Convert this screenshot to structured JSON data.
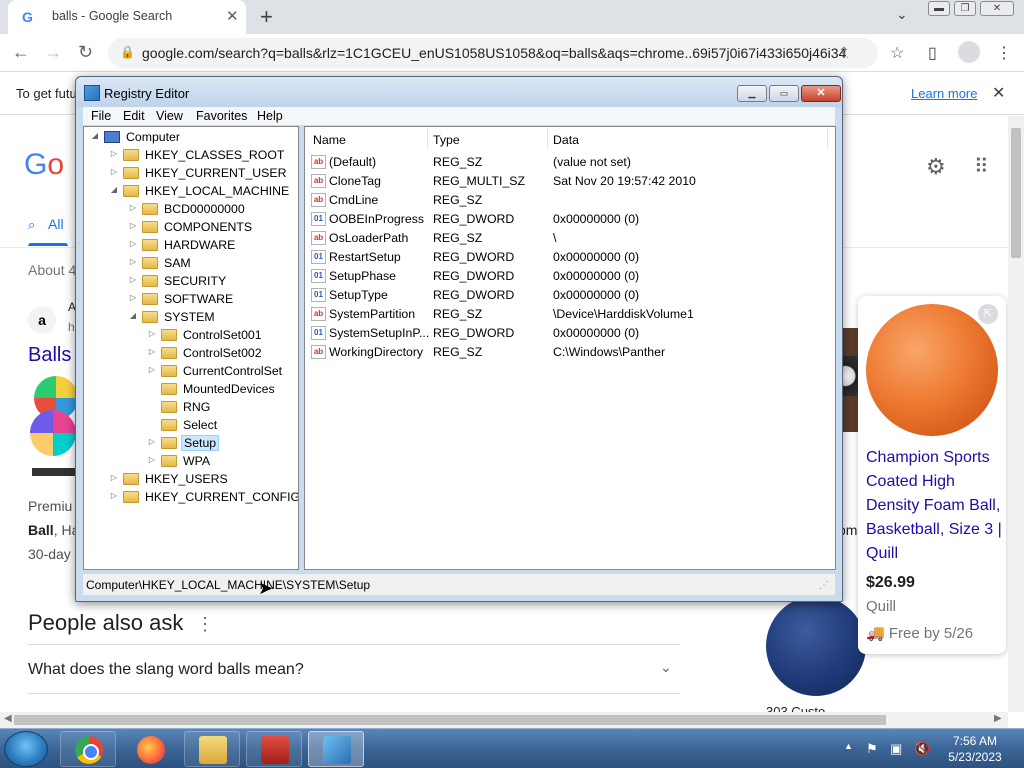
{
  "browser": {
    "tab_title": "balls - Google Search",
    "tab_favicon": "G",
    "new_tab": "+",
    "url": "google.com/search?q=balls&rlz=1C1GCEU_enUS1058US1058&oq=balls&aqs=chrome..69i57j0i67i433i650j46i34...",
    "infobar_text": "To get futu",
    "infobar_link": "Learn more"
  },
  "google": {
    "logo_g": "G",
    "logo_o": "o",
    "tab_all": "All",
    "about": "About 4",
    "amazon_a": "A",
    "amazon_h": "h",
    "result_title": "Balls",
    "snippet1": "Premiu",
    "snippet2_bold": "Ball",
    "snippet2_rest": ", Ha",
    "snippet3": "30-day",
    "om_text": "om",
    "paa_title": "People also ask",
    "paa_question": "What does the slang word balls mean?",
    "blue_ball_caption": "303 Custo",
    "product": {
      "title": "Champion Sports Coated High Density Foam Ball, Basketball, Size 3 | Quill",
      "price": "$26.99",
      "seller": "Quill",
      "shipping": "Free by 5/26"
    }
  },
  "regedit": {
    "title": "Registry Editor",
    "menu": [
      "File",
      "Edit",
      "View",
      "Favorites",
      "Help"
    ],
    "tree": [
      {
        "label": "Computer",
        "depth": 0,
        "exp": "◢",
        "root": true
      },
      {
        "label": "HKEY_CLASSES_ROOT",
        "depth": 1,
        "exp": "▷"
      },
      {
        "label": "HKEY_CURRENT_USER",
        "depth": 1,
        "exp": "▷"
      },
      {
        "label": "HKEY_LOCAL_MACHINE",
        "depth": 1,
        "exp": "◢"
      },
      {
        "label": "BCD00000000",
        "depth": 2,
        "exp": "▷"
      },
      {
        "label": "COMPONENTS",
        "depth": 2,
        "exp": "▷"
      },
      {
        "label": "HARDWARE",
        "depth": 2,
        "exp": "▷"
      },
      {
        "label": "SAM",
        "depth": 2,
        "exp": "▷"
      },
      {
        "label": "SECURITY",
        "depth": 2,
        "exp": "▷"
      },
      {
        "label": "SOFTWARE",
        "depth": 2,
        "exp": "▷"
      },
      {
        "label": "SYSTEM",
        "depth": 2,
        "exp": "◢"
      },
      {
        "label": "ControlSet001",
        "depth": 3,
        "exp": "▷"
      },
      {
        "label": "ControlSet002",
        "depth": 3,
        "exp": "▷"
      },
      {
        "label": "CurrentControlSet",
        "depth": 3,
        "exp": "▷"
      },
      {
        "label": "MountedDevices",
        "depth": 3,
        "exp": ""
      },
      {
        "label": "RNG",
        "depth": 3,
        "exp": ""
      },
      {
        "label": "Select",
        "depth": 3,
        "exp": ""
      },
      {
        "label": "Setup",
        "depth": 3,
        "exp": "▷",
        "selected": true
      },
      {
        "label": "WPA",
        "depth": 3,
        "exp": "▷"
      },
      {
        "label": "HKEY_USERS",
        "depth": 1,
        "exp": "▷"
      },
      {
        "label": "HKEY_CURRENT_CONFIG",
        "depth": 1,
        "exp": "▷"
      }
    ],
    "columns": [
      "Name",
      "Type",
      "Data"
    ],
    "values": [
      {
        "icon": "ab",
        "name": "(Default)",
        "type": "REG_SZ",
        "data": "(value not set)"
      },
      {
        "icon": "ab",
        "name": "CloneTag",
        "type": "REG_MULTI_SZ",
        "data": "Sat Nov 20 19:57:42 2010"
      },
      {
        "icon": "ab",
        "name": "CmdLine",
        "type": "REG_SZ",
        "data": ""
      },
      {
        "icon": "bin",
        "name": "OOBEInProgress",
        "type": "REG_DWORD",
        "data": "0x00000000 (0)"
      },
      {
        "icon": "ab",
        "name": "OsLoaderPath",
        "type": "REG_SZ",
        "data": "\\"
      },
      {
        "icon": "bin",
        "name": "RestartSetup",
        "type": "REG_DWORD",
        "data": "0x00000000 (0)"
      },
      {
        "icon": "bin",
        "name": "SetupPhase",
        "type": "REG_DWORD",
        "data": "0x00000000 (0)"
      },
      {
        "icon": "bin",
        "name": "SetupType",
        "type": "REG_DWORD",
        "data": "0x00000000 (0)"
      },
      {
        "icon": "ab",
        "name": "SystemPartition",
        "type": "REG_SZ",
        "data": "\\Device\\HarddiskVolume1"
      },
      {
        "icon": "bin",
        "name": "SystemSetupInP...",
        "type": "REG_DWORD",
        "data": "0x00000000 (0)"
      },
      {
        "icon": "ab",
        "name": "WorkingDirectory",
        "type": "REG_SZ",
        "data": "C:\\Windows\\Panther"
      }
    ],
    "status_path": "Computer\\HKEY_LOCAL_MACHINE\\SYSTEM\\Setup"
  },
  "taskbar": {
    "time": "7:56 AM",
    "date": "5/23/2023"
  }
}
